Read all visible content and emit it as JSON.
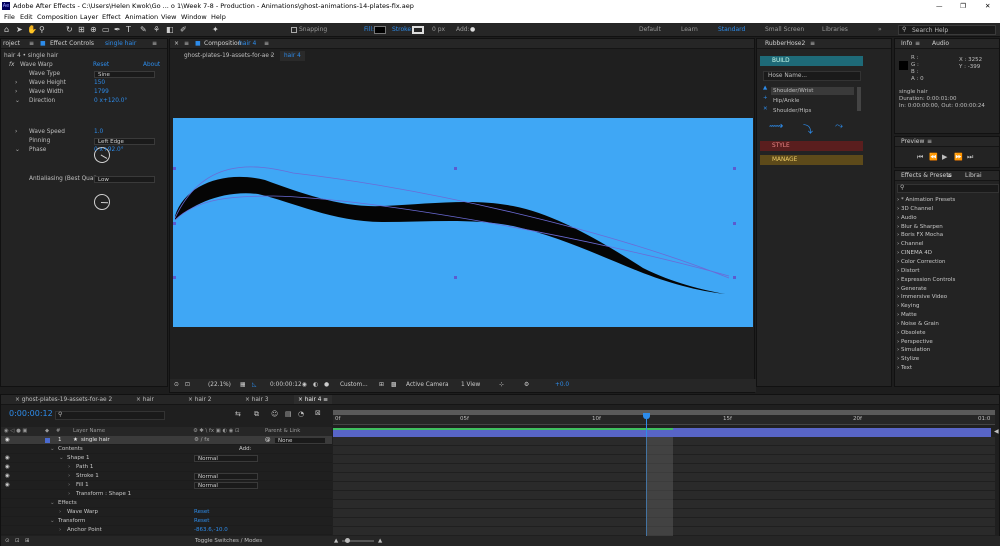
{
  "title_bar": {
    "title": "Adobe After Effects - C:\\Users\\Helen Kwok\\Go ... o 1\\Week 7-8 - Production - Animations\\ghost-animations-14-plates-fix.aep",
    "controls": [
      "—",
      "❐",
      "✕"
    ]
  },
  "menu": [
    "File",
    "Edit",
    "Composition",
    "Layer",
    "Effect",
    "Animation",
    "View",
    "Window",
    "Help"
  ],
  "toolbar": {
    "snapping": "Snapping",
    "fill": "Fill:",
    "stroke": "Stroke:",
    "stroke_px": "0 px",
    "add": "Add:",
    "workspaces": [
      "Default",
      "Learn",
      "Standard",
      "Small Screen",
      "Libraries"
    ],
    "search_placeholder": "Search Help"
  },
  "effect_controls": {
    "project_tab": "roject",
    "header_prefix": "Effect Controls",
    "header_layer": "single hair",
    "breadcrumb": "hair 4 • single hair",
    "effect_name": "Wave Warp",
    "reset": "Reset",
    "about": "About",
    "props": [
      {
        "label": "Wave Type",
        "value": "Sine"
      },
      {
        "label": "Wave Height",
        "value": "150"
      },
      {
        "label": "Wave Width",
        "value": "1799"
      },
      {
        "label": "Direction",
        "value": "0 x+120.0°"
      },
      {
        "label": "Wave Speed",
        "value": "1.0"
      },
      {
        "label": "Pinning",
        "value": "Left Edge"
      },
      {
        "label": "Phase",
        "value": "0 x+92.0°"
      },
      {
        "label": "Antialiasing (Best Quali",
        "value": "Low"
      }
    ]
  },
  "composition": {
    "header_prefix": "Composition",
    "header_comp": "hair 4",
    "breadcrumb_a": "ghost-plates-19-assets-for-ae 2",
    "breadcrumb_b": "hair 4",
    "zoom": "(22.1%)",
    "timecode": "0:00:00:12",
    "resolution": "Custom...",
    "camera": "Active Camera",
    "view": "1 View",
    "exposure": "+0.0",
    "bg_color": "#3fa7f5"
  },
  "rubberhose": {
    "title": "RubberHose2",
    "build": "BUILD",
    "hose_name_placeholder": "Hose Name...",
    "list": [
      "Shoulder/Wrist",
      "Hip/Ankle",
      "Shoulder/Hips"
    ],
    "style": "STYLE",
    "manage": "MANAGE"
  },
  "info": {
    "tab_info": "Info",
    "tab_audio": "Audio",
    "channels": [
      "R :",
      "G :",
      "B :",
      "A : 0"
    ],
    "x": "X : 3252",
    "y": "Y : -399",
    "layer": "single hair",
    "duration": "Duration: 0:00:01:00",
    "inout": "In: 0:00:00:00, Out: 0:00:00:24"
  },
  "preview": {
    "title": "Preview"
  },
  "effects_presets": {
    "title": "Effects & Presets",
    "tab2": "Librai",
    "search_placeholder": "",
    "items": [
      "* Animation Presets",
      "3D Channel",
      "Audio",
      "Blur & Sharpen",
      "Boris FX Mocha",
      "Channel",
      "CINEMA 4D",
      "Color Correction",
      "Distort",
      "Expression Controls",
      "Generate",
      "Immersive Video",
      "Keying",
      "Matte",
      "Noise & Grain",
      "Obsolete",
      "Perspective",
      "Simulation",
      "Stylize",
      "Text"
    ]
  },
  "timeline": {
    "tabs": [
      "ghost-plates-19-assets-for-ae 2",
      "hair",
      "hair 2",
      "hair 3",
      "hair 4"
    ],
    "active_tab": 4,
    "timecode": "0:00:00:12",
    "col_layer_name": "Layer Name",
    "col_parent": "Parent & Link",
    "layer_number": "1",
    "layer_name": "single hair",
    "parent": "None",
    "ruler": [
      "0f",
      "05f",
      "10f",
      "15f",
      "20f",
      "01:0"
    ],
    "rows": [
      {
        "label": "Contents",
        "indent": 1,
        "value": "",
        "add": "Add:"
      },
      {
        "label": "Shape 1",
        "indent": 2,
        "value": "Normal"
      },
      {
        "label": "Path 1",
        "indent": 3,
        "value": ""
      },
      {
        "label": "Stroke 1",
        "indent": 3,
        "value": "Normal"
      },
      {
        "label": "Fill 1",
        "indent": 3,
        "value": "Normal"
      },
      {
        "label": "Transform : Shape 1",
        "indent": 3,
        "value": ""
      },
      {
        "label": "Effects",
        "indent": 1,
        "value": ""
      },
      {
        "label": "Wave Warp",
        "indent": 2,
        "value": "Reset"
      },
      {
        "label": "Transform",
        "indent": 1,
        "value": "Reset"
      },
      {
        "label": "Anchor Point",
        "indent": 2,
        "value": "-863.6,-10.0"
      }
    ],
    "footer": "Toggle Switches / Modes"
  }
}
